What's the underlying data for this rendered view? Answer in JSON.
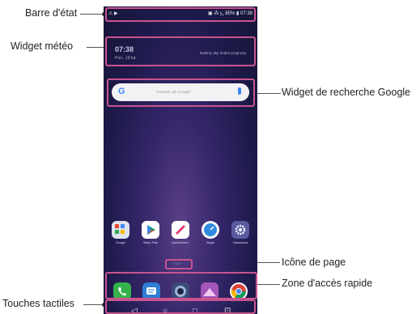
{
  "callouts": {
    "status_bar": "Barre d'état",
    "weather_widget": "Widget météo",
    "google_widget": "Widget de recherche Google",
    "page_icon": "Icône de page",
    "quick_access": "Zone d'accès rapide",
    "touch_keys": "Touches tactiles"
  },
  "status": {
    "left": "⚠ ▶",
    "right": "▣ ⁂ ◺ 85% ▮ 07:38"
  },
  "weather": {
    "time": "07:38",
    "date": "Pon., 18 lut.",
    "hint": "Dotknij, aby dodać prognozę"
  },
  "search": {
    "logo": "G",
    "hint": "Powiedz „Ok Google\""
  },
  "apps": [
    {
      "label": "Google",
      "color": "#dfe3ee",
      "icon": "google-folder-icon"
    },
    {
      "label": "Sklep Play",
      "color": "#ffffff",
      "icon": "play-store-icon"
    },
    {
      "label": "QuickMemo+",
      "color": "#ffffff",
      "icon": "quickmemo-icon"
    },
    {
      "label": "Zegar",
      "color": "#ffffff",
      "icon": "clock-icon"
    },
    {
      "label": "Ustawienia",
      "color": "#5a5aa0",
      "icon": "settings-icon"
    }
  ],
  "page_indicator": "‹ ⌂ ›",
  "dock": [
    {
      "icon": "phone-icon",
      "color": "#35b24a"
    },
    {
      "icon": "messages-icon",
      "color": "#2d7ed6"
    },
    {
      "icon": "camera-icon",
      "color": "#3a4a78"
    },
    {
      "icon": "gallery-icon",
      "color": "#a455b8"
    },
    {
      "icon": "chrome-icon",
      "color": "#ffffff"
    }
  ],
  "nav": {
    "back": "◁",
    "home": "○",
    "recents": "□",
    "extra": "⊡"
  },
  "highlight_color": "#c9548f"
}
